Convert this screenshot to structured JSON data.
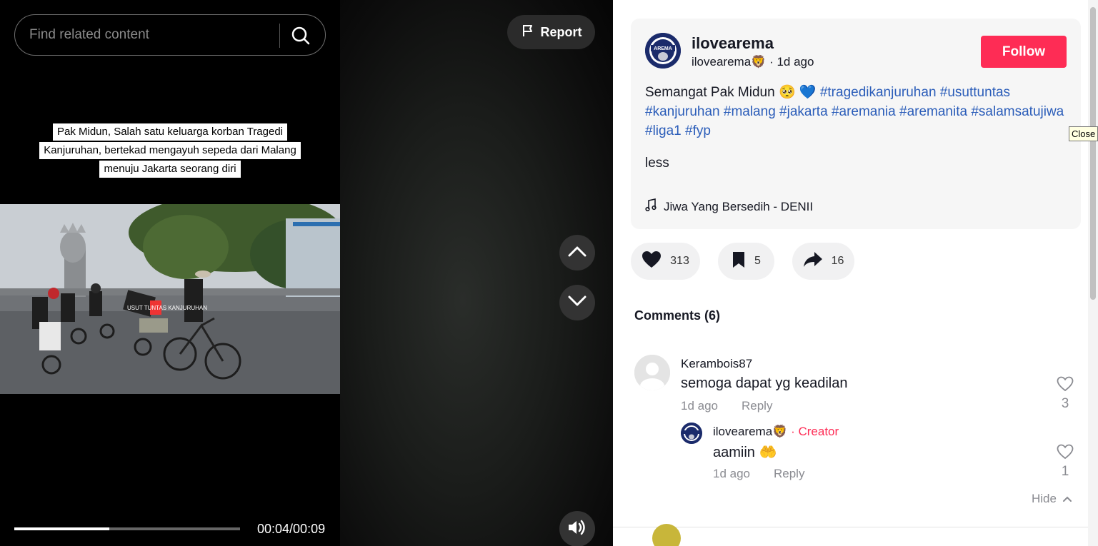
{
  "search": {
    "placeholder": "Find related content"
  },
  "report": {
    "label": "Report"
  },
  "video": {
    "caption_lines": [
      "Pak Midun, Salah satu keluarga korban Tragedi",
      "Kanjuruhan, bertekad mengayuh sepeda dari Malang",
      "menuju Jakarta seorang diri"
    ],
    "sign_text": "USUT TUNTAS KANJURUHAN",
    "time": "00:04/00:09",
    "progress": 0.42
  },
  "author": {
    "name": "ilovearema",
    "handle": "ilovearema🦁",
    "age": "1d ago",
    "avatar_text": "AREMA"
  },
  "follow": {
    "label": "Follow"
  },
  "description": {
    "text": "Semangat Pak Midun 🥺 💙",
    "hashtags": [
      "#tragedikanjuruhan",
      "#usuttuntas",
      "#kanjuruhan",
      "#malang",
      "#jakarta",
      "#aremania",
      "#aremanita",
      "#salamsatujiwa",
      "#liga1",
      "#fyp"
    ],
    "less": "less"
  },
  "music": {
    "title": "Jiwa Yang Bersedih - DENII"
  },
  "actions": {
    "likes": "313",
    "saves": "5",
    "shares": "16"
  },
  "comments": {
    "title": "Comments (6)",
    "items": [
      {
        "user": "Kerambois87",
        "text": "semoga dapat yg keadilan",
        "age": "1d ago",
        "reply": "Reply",
        "likes": "3"
      }
    ],
    "reply": {
      "user": "ilovearema🦁",
      "separator": "·",
      "badge": "Creator",
      "text": "aamiin 🤲",
      "age": "1d ago",
      "reply": "Reply",
      "likes": "1"
    },
    "hide": "Hide"
  },
  "tooltip": "Close",
  "colors": {
    "accent": "#fe2c55",
    "hashtag": "#2b5db9",
    "panel_bg": "#ffffff",
    "card_bg": "#f6f6f6"
  }
}
